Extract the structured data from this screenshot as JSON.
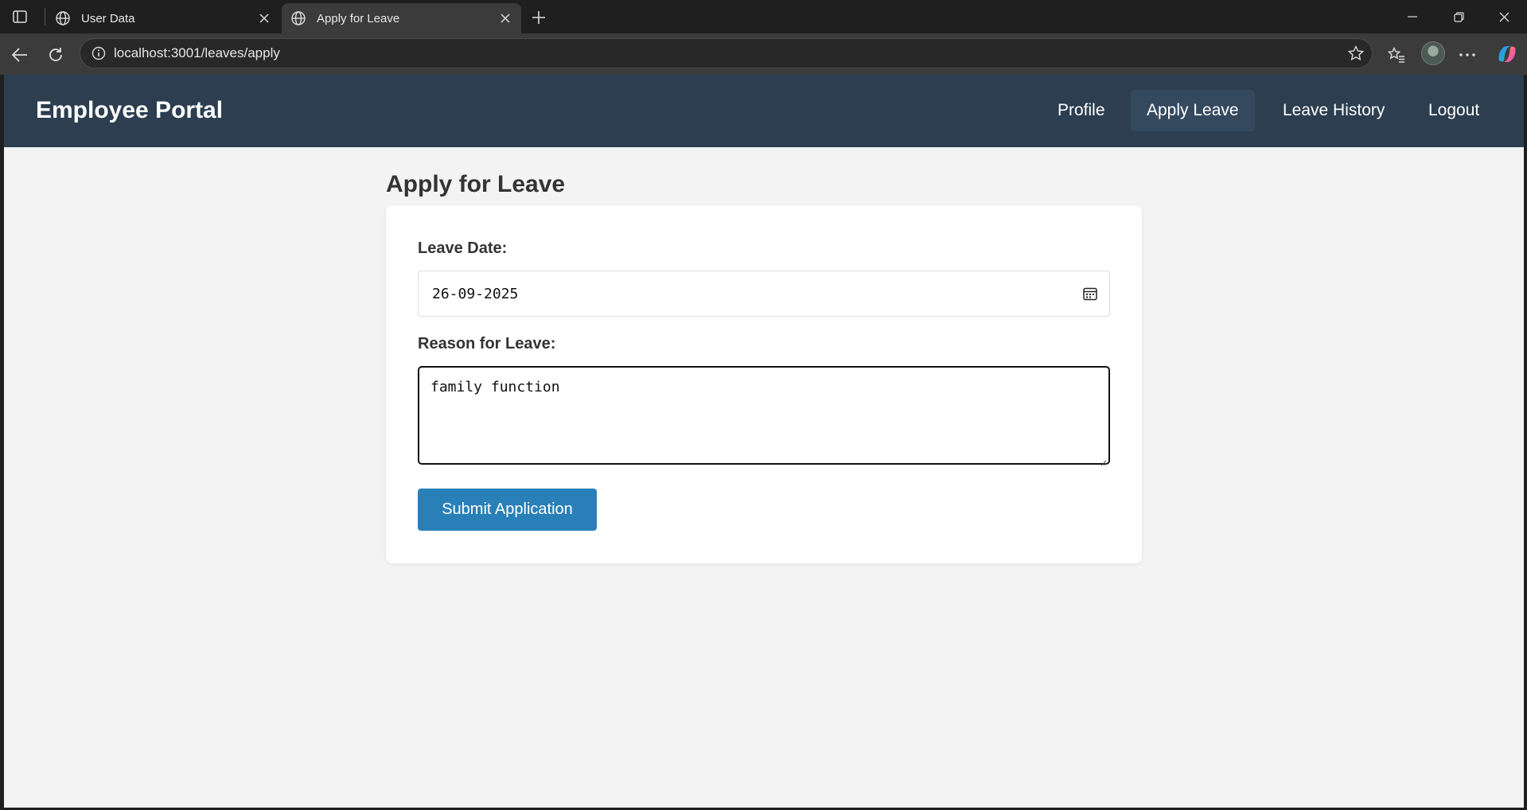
{
  "browser": {
    "tabs": [
      {
        "title": "User Data",
        "active": false
      },
      {
        "title": "Apply for Leave",
        "active": true
      }
    ],
    "url": "localhost:3001/leaves/apply"
  },
  "navbar": {
    "brand": "Employee Portal",
    "links": [
      {
        "label": "Profile",
        "active": false
      },
      {
        "label": "Apply Leave",
        "active": true
      },
      {
        "label": "Leave History",
        "active": false
      },
      {
        "label": "Logout",
        "active": false
      }
    ]
  },
  "page": {
    "title": "Apply for Leave"
  },
  "form": {
    "date_label": "Leave Date:",
    "date_value": "26-09-2025",
    "reason_label": "Reason for Leave:",
    "reason_value": "family function",
    "submit_label": "Submit Application"
  },
  "colors": {
    "navbar_bg": "#2c3e50",
    "nav_active_bg": "#34495e",
    "submit_bg": "#2980b9",
    "page_bg": "#f3f3f3"
  }
}
